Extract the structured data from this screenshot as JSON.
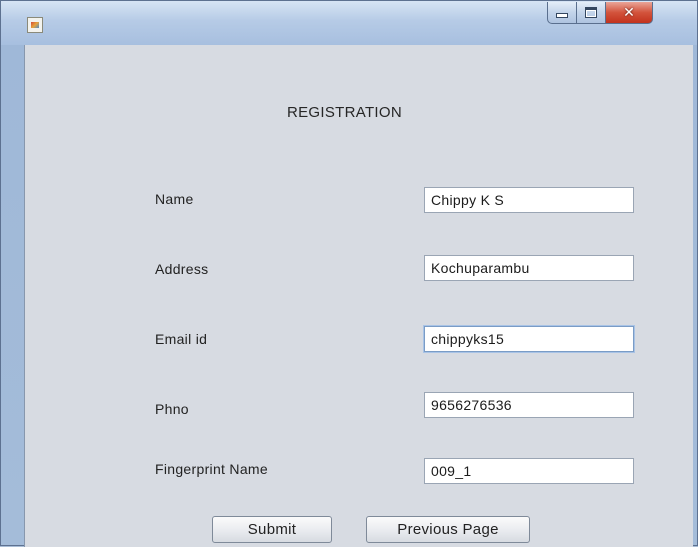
{
  "window": {
    "controls": {
      "minimize": "–",
      "maximize": "□",
      "close": "✕"
    }
  },
  "form": {
    "title": "REGISTRATION",
    "fields": [
      {
        "label": "Name",
        "value": "Chippy K S"
      },
      {
        "label": "Address",
        "value": "Kochuparambu"
      },
      {
        "label": "Email id",
        "value": "chippyks15"
      },
      {
        "label": "Phno",
        "value": "9656276536"
      },
      {
        "label": "Fingerprint Name",
        "value": "009_1"
      }
    ],
    "submit_label": "Submit",
    "previous_label": "Previous Page"
  },
  "colors": {
    "window_frame": "#a4bcd9",
    "content_bg": "#d7dbe2",
    "close_button": "#c2321d"
  }
}
